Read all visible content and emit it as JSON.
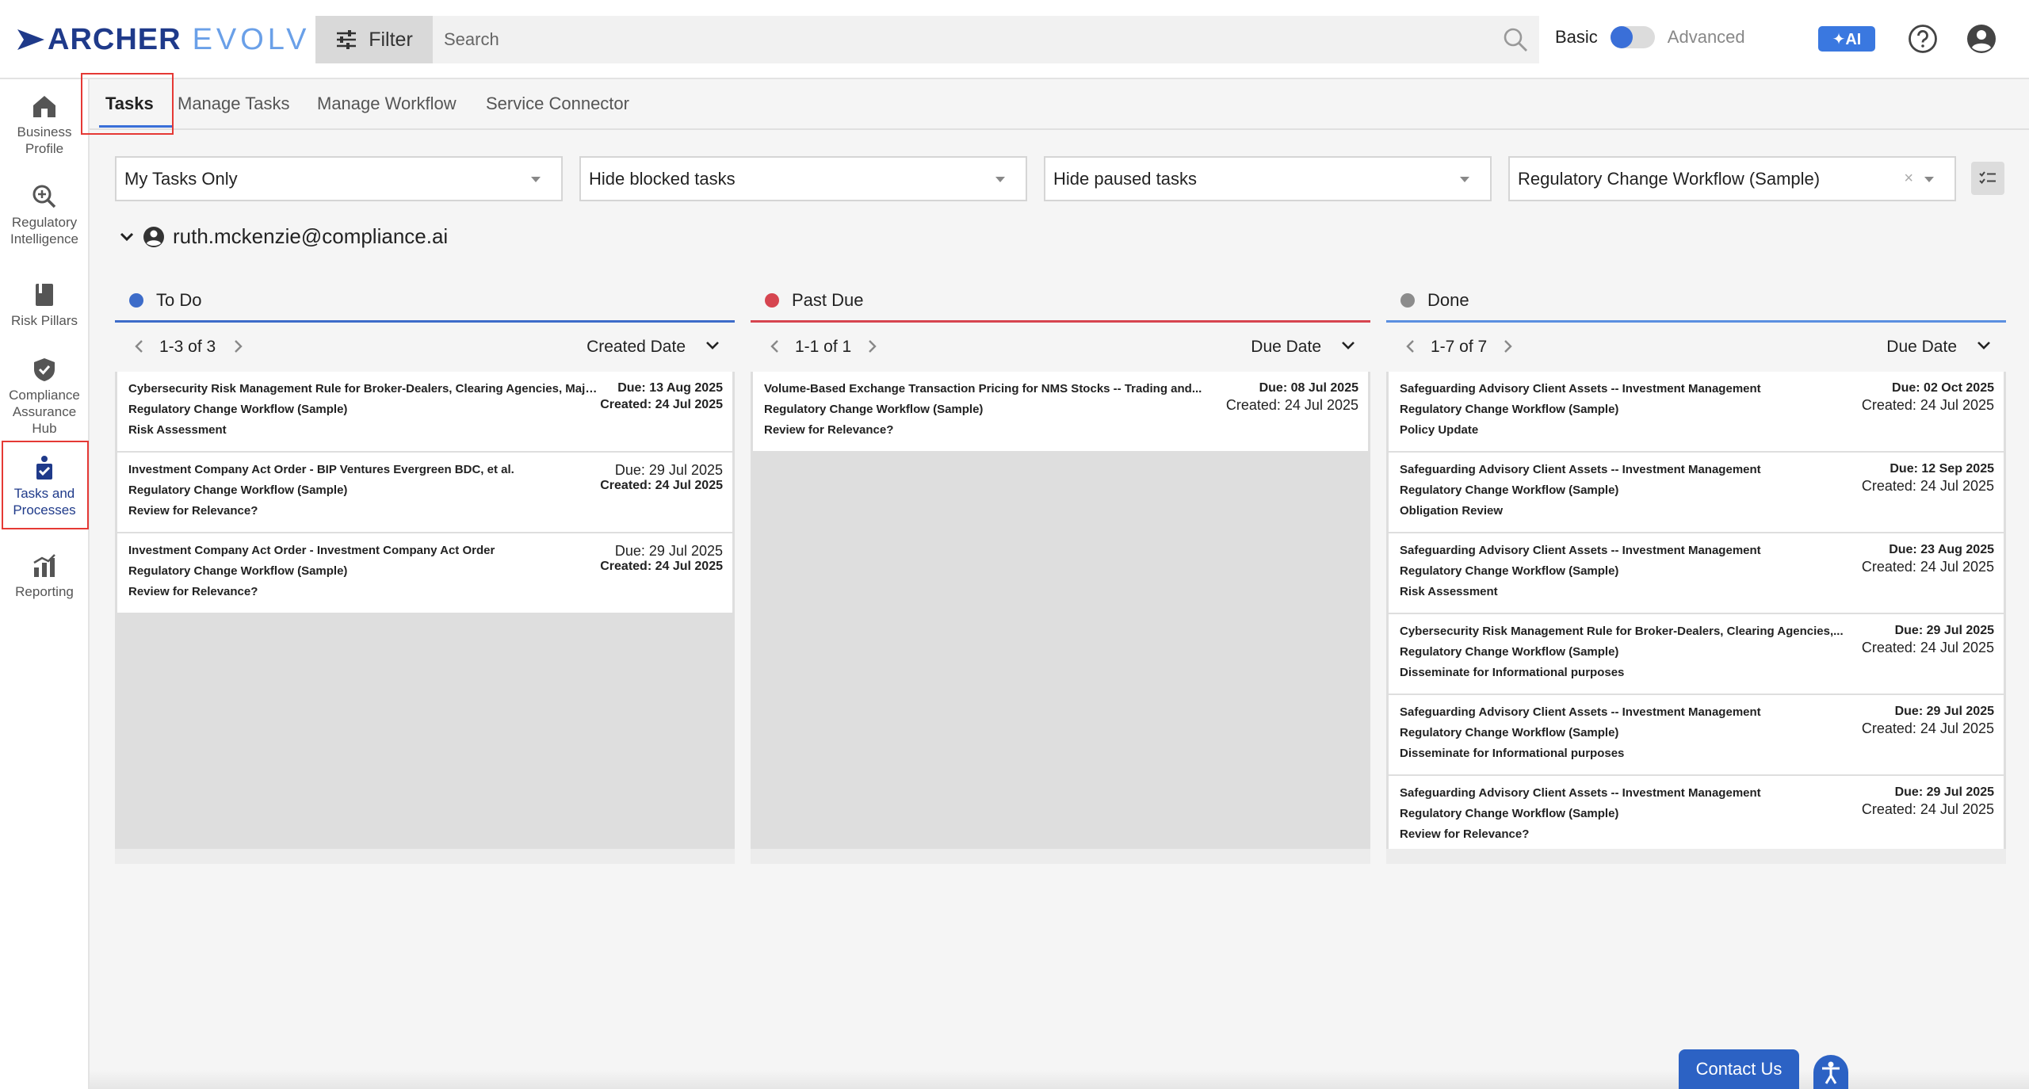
{
  "header": {
    "logo_primary": "ARCHER",
    "logo_secondary": "EVOLV",
    "filter_label": "Filter",
    "search_placeholder": "Search",
    "mode_basic": "Basic",
    "mode_advanced": "Advanced",
    "ai_label": "✦AI",
    "accent_color": "#3a6fd8"
  },
  "sidebar": {
    "items": [
      {
        "label": "Business Profile",
        "icon": "home-icon"
      },
      {
        "label": "Regulatory Intelligence",
        "icon": "magnify-icon"
      },
      {
        "label": "Risk Pillars",
        "icon": "book-icon"
      },
      {
        "label": "Compliance Assurance Hub",
        "icon": "shield-check-icon"
      },
      {
        "label": "Tasks and Processes",
        "icon": "tasks-icon",
        "active": true
      },
      {
        "label": "Reporting",
        "icon": "chart-icon"
      }
    ]
  },
  "tabs": [
    {
      "label": "Tasks",
      "active": true
    },
    {
      "label": "Manage Tasks"
    },
    {
      "label": "Manage Workflow"
    },
    {
      "label": "Service Connector"
    }
  ],
  "filters": {
    "tasks_scope": "My Tasks Only",
    "blocked": "Hide blocked tasks",
    "paused": "Hide paused tasks",
    "workflow": "Regulatory Change Workflow (Sample)",
    "clear": "×"
  },
  "user": {
    "email": "ruth.mckenzie@compliance.ai"
  },
  "columns": [
    {
      "title": "To Do",
      "color": "#3d6cc9",
      "count": "1-3 of 3",
      "sort": "Created Date",
      "cards": [
        {
          "title": "Cybersecurity Risk Management Rule for Broker-Dealers, Clearing Agencies, Major...",
          "workflow": "Regulatory Change Workflow (Sample)",
          "step": "Risk Assessment",
          "due": "Due: 13 Aug 2025",
          "created": "Created: 24 Jul 2025"
        },
        {
          "title": "Investment Company Act Order - BIP Ventures Evergreen BDC, et al.",
          "workflow": "Regulatory Change Workflow (Sample)",
          "step": "Review for Relevance?",
          "due": "Due: 29 Jul 2025",
          "created": "Created: 24 Jul 2025"
        },
        {
          "title": "Investment Company Act Order - Investment Company Act Order",
          "workflow": "Regulatory Change Workflow (Sample)",
          "step": "Review for Relevance?",
          "due": "Due: 29 Jul 2025",
          "created": "Created: 24 Jul 2025"
        }
      ]
    },
    {
      "title": "Past Due",
      "color": "#d64550",
      "count": "1-1 of 1",
      "sort": "Due Date",
      "cards": [
        {
          "title": "Volume-Based Exchange Transaction Pricing for NMS Stocks -- Trading and...",
          "workflow": "Regulatory Change Workflow (Sample)",
          "step": "Review for Relevance?",
          "due": "Due: 08 Jul 2025",
          "created": "Created: 24 Jul 2025"
        }
      ]
    },
    {
      "title": "Done",
      "color": "#8c8c8c",
      "line_color": "#5b8fe0",
      "count": "1-7 of 7",
      "sort": "Due Date",
      "cards": [
        {
          "title": "Safeguarding Advisory Client Assets -- Investment Management",
          "workflow": "Regulatory Change Workflow (Sample)",
          "step": "Policy Update",
          "due": "Due: 02 Oct 2025",
          "created": "Created: 24 Jul 2025"
        },
        {
          "title": "Safeguarding Advisory Client Assets -- Investment Management",
          "workflow": "Regulatory Change Workflow (Sample)",
          "step": "Obligation Review",
          "due": "Due: 12 Sep 2025",
          "created": "Created: 24 Jul 2025"
        },
        {
          "title": "Safeguarding Advisory Client Assets -- Investment Management",
          "workflow": "Regulatory Change Workflow (Sample)",
          "step": "Risk Assessment",
          "due": "Due: 23 Aug 2025",
          "created": "Created: 24 Jul 2025"
        },
        {
          "title": "Cybersecurity Risk Management Rule for Broker-Dealers, Clearing Agencies,...",
          "workflow": "Regulatory Change Workflow (Sample)",
          "step": "Disseminate for Informational purposes",
          "due": "Due: 29 Jul 2025",
          "created": "Created: 24 Jul 2025"
        },
        {
          "title": "Safeguarding Advisory Client Assets -- Investment Management",
          "workflow": "Regulatory Change Workflow (Sample)",
          "step": "Disseminate for Informational purposes",
          "due": "Due: 29 Jul 2025",
          "created": "Created: 24 Jul 2025"
        },
        {
          "title": "Safeguarding Advisory Client Assets -- Investment Management",
          "workflow": "Regulatory Change Workflow (Sample)",
          "step": "Review for Relevance?",
          "due": "Due: 29 Jul 2025",
          "created": "Created: 24 Jul 2025"
        }
      ]
    }
  ],
  "footer": {
    "contact_label": "Contact Us"
  }
}
